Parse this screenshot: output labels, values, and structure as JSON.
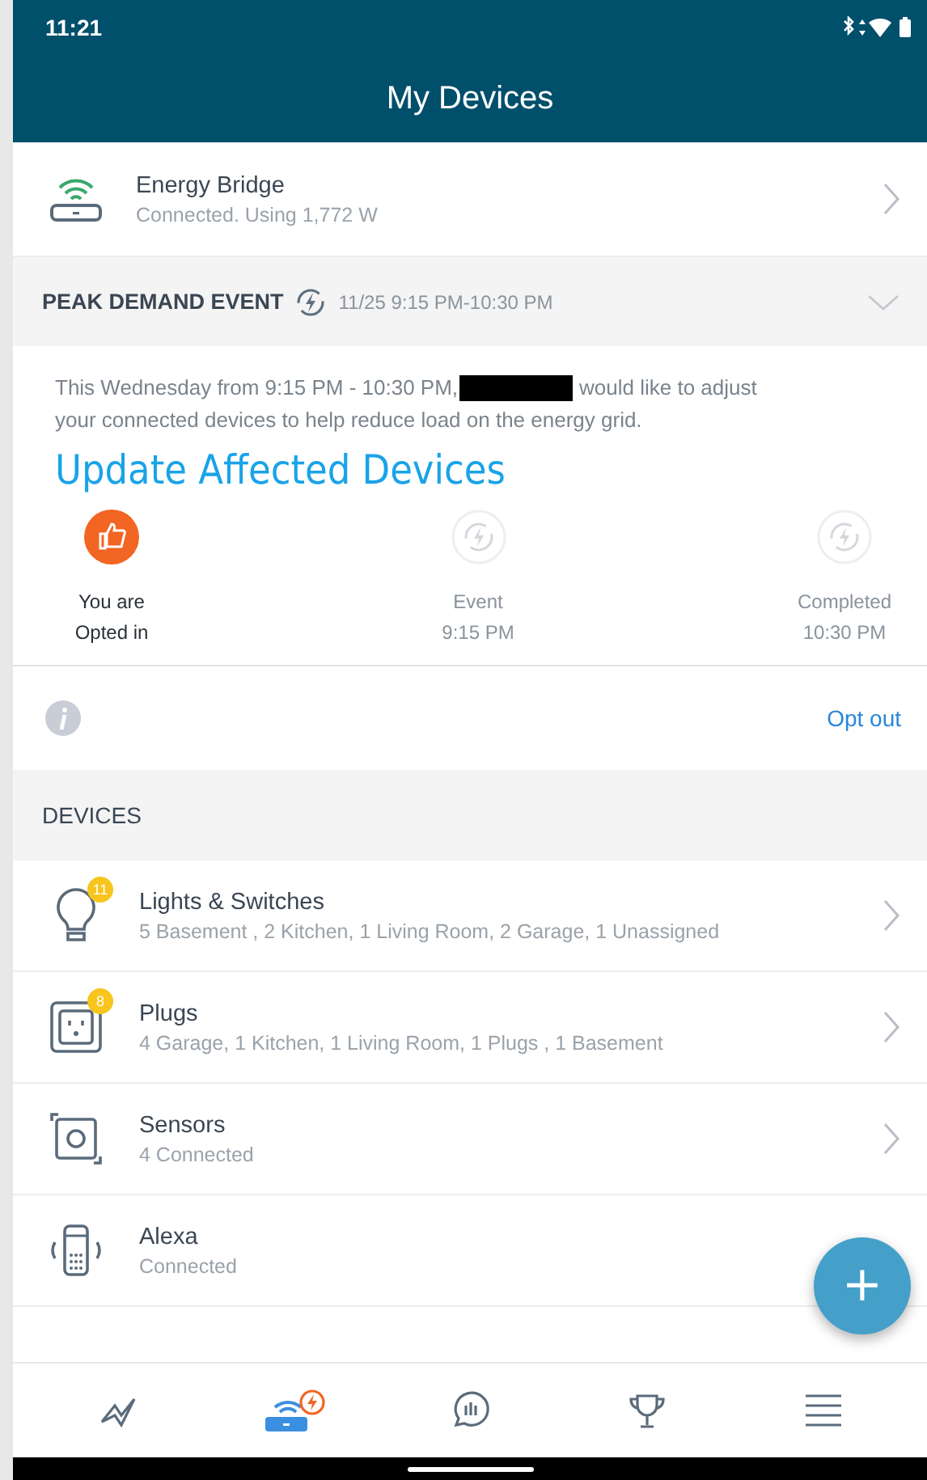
{
  "status_bar": {
    "time": "11:21"
  },
  "header": {
    "title": "My Devices"
  },
  "bridge": {
    "name": "Energy Bridge",
    "status": "Connected. Using 1,772 W"
  },
  "event": {
    "title": "PEAK DEMAND EVENT",
    "time": "11/25 9:15 PM-10:30 PM",
    "expanded": true,
    "message_before": "This Wednesday from 9:15 PM - 10:30 PM,",
    "redacted": true,
    "message_after": "would like to adjust",
    "message_line2": "your connected devices to help reduce load on the energy grid.",
    "update_link": "Update Affected Devices",
    "steps": [
      {
        "lines": [
          "You are",
          "Opted in"
        ],
        "done": true
      },
      {
        "lines": [
          "Event",
          "9:15 PM"
        ],
        "done": false
      },
      {
        "lines": [
          "Completed",
          "10:30 PM"
        ],
        "done": false
      }
    ],
    "opt_out": "Opt out"
  },
  "devices_heading": "DEVICES",
  "devices": [
    {
      "kind": "light",
      "name": "Lights & Switches",
      "detail": "5 Basement , 2 Kitchen, 1 Living Room, 2 Garage, 1 Unassigned",
      "badge": "11",
      "chevron": true
    },
    {
      "kind": "plug",
      "name": "Plugs",
      "detail": "4 Garage, 1 Kitchen, 1 Living Room, 1 Plugs , 1 Basement",
      "badge": "8",
      "chevron": true
    },
    {
      "kind": "sensor",
      "name": "Sensors",
      "detail": "4 Connected",
      "chevron": true
    },
    {
      "kind": "alexa",
      "name": "Alexa",
      "detail": "Connected",
      "chevron": false
    }
  ],
  "fab": "+",
  "nav": [
    {
      "kind": "insights",
      "selected": false
    },
    {
      "kind": "devices",
      "selected": true
    },
    {
      "kind": "chat",
      "selected": false
    },
    {
      "kind": "trophy",
      "selected": false
    },
    {
      "kind": "menu",
      "selected": false
    }
  ]
}
